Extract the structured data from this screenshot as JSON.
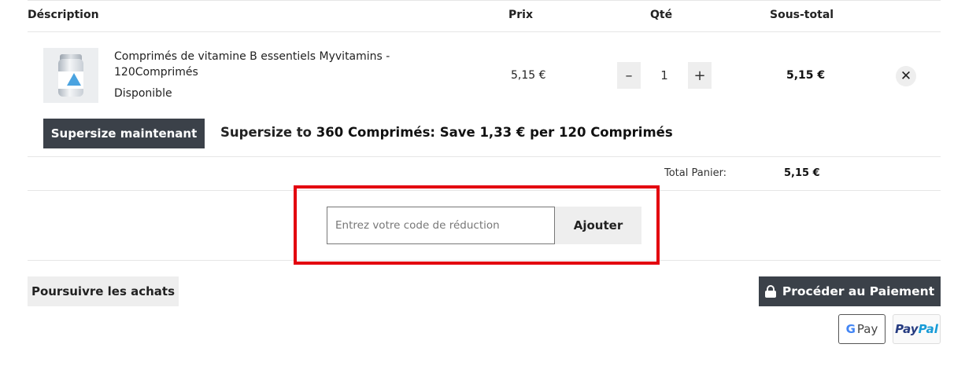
{
  "table": {
    "headers": {
      "description": "Déscription",
      "price": "Prix",
      "qty": "Qté",
      "subtotal": "Sous-total"
    }
  },
  "item": {
    "name": "Comprimés de vitamine B essentiels Myvitamins - 120Comprimés",
    "availability": "Disponible",
    "price": "5,15 €",
    "quantity": "1",
    "decrement_label": "–",
    "increment_label": "+",
    "subtotal": "5,15 €",
    "remove_label": "✕",
    "image": "vitamin-bottle-product-image"
  },
  "supersize": {
    "button_label": "Supersize maintenant",
    "text_prefix": "Supersize to ",
    "text_highlight": "360 Comprimés: Save 1,33 € per 120 Comprimés"
  },
  "totals": {
    "label": "Total Panier:",
    "value": "5,15 €"
  },
  "coupon": {
    "placeholder": "Entrez votre code de réduction",
    "button_label": "Ajouter"
  },
  "actions": {
    "continue_label": "Poursuivre les achats",
    "checkout_label": "Procéder au Paiement",
    "checkout_icon": "lock-icon"
  },
  "payments": {
    "gpay_g": "G",
    "gpay_text": "Pay",
    "paypal_part1": "Pay",
    "paypal_part2": "Pal"
  },
  "colors": {
    "dark_button": "#3b4149",
    "highlight_border": "#e3000f",
    "light_button": "#eeeeee"
  }
}
